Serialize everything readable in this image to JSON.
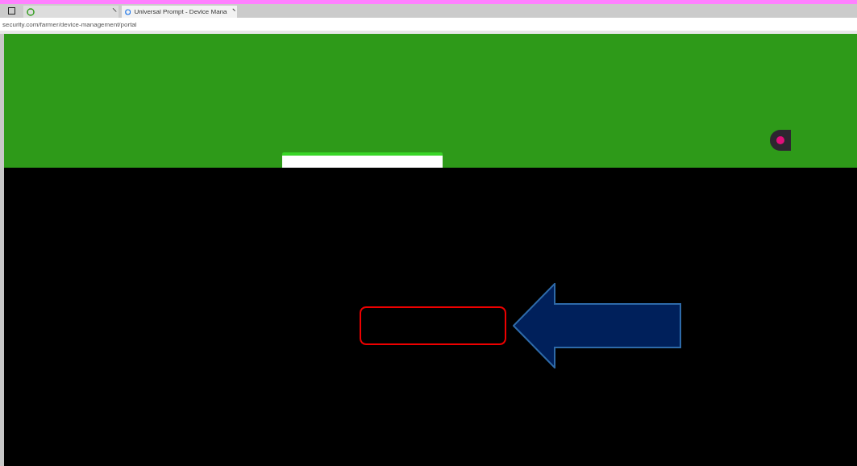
{
  "browser": {
    "tabs": [
      {
        "selected": false
      },
      {
        "title": "Universal Prompt - Device Mana",
        "selected": true
      }
    ],
    "address": "security.com/farmer/device-management/portal"
  }
}
